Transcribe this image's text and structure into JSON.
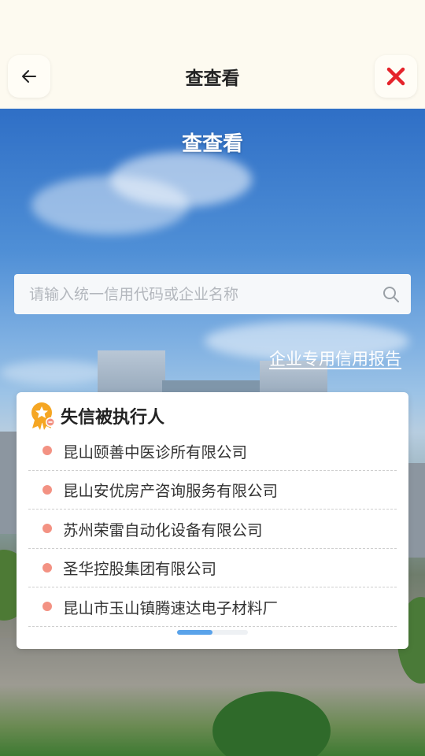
{
  "header": {
    "title": "查查看",
    "back_icon": "arrow-left-icon",
    "close_icon": "close-x-icon",
    "close_color": "#e5242b"
  },
  "hero": {
    "title": "查查看",
    "search": {
      "placeholder": "请输入统一信用代码或企业名称",
      "value": "",
      "icon": "search-icon"
    },
    "report_link": "企业专用信用报告"
  },
  "card": {
    "icon": "award-badge-icon",
    "title": "失信被执行人",
    "items": [
      "昆山颐善中医诊所有限公司",
      "昆山安优房产咨询服务有限公司",
      "苏州荣雷自动化设备有限公司",
      "圣华控股集团有限公司",
      "昆山市玉山镇腾速达电子材料厂"
    ],
    "accent_color": "#f39283",
    "scroll_progress": 0.5
  }
}
